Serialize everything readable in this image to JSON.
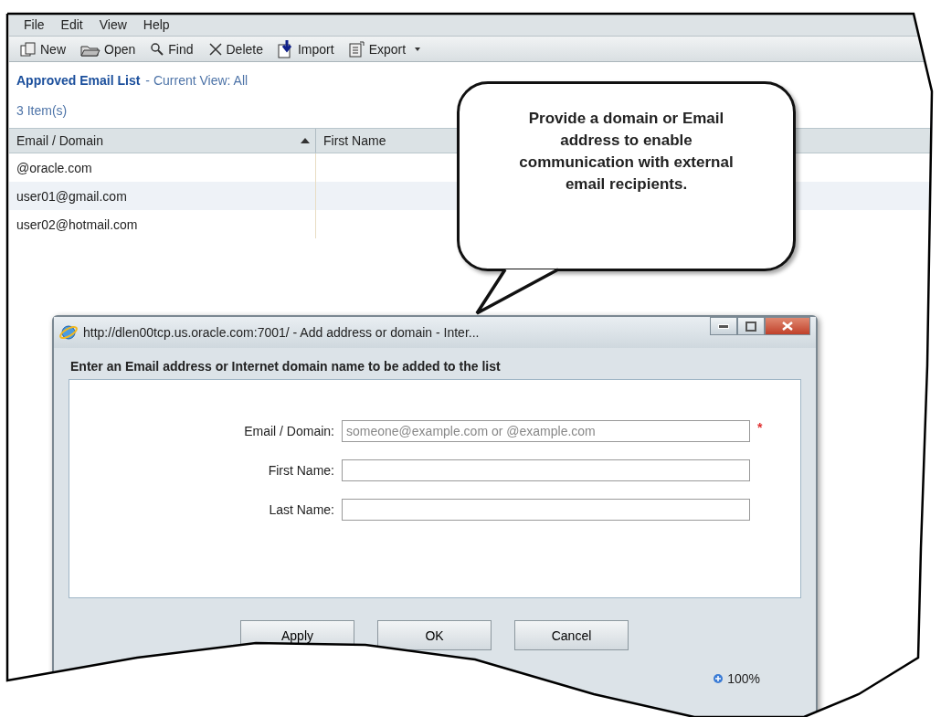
{
  "menu": [
    "File",
    "Edit",
    "View",
    "Help"
  ],
  "toolbar": [
    {
      "kind": "new",
      "label": "New",
      "has_menu": false
    },
    {
      "kind": "open",
      "label": "Open",
      "has_menu": false
    },
    {
      "kind": "find",
      "label": "Find",
      "has_menu": false
    },
    {
      "kind": "delete",
      "label": "Delete",
      "has_menu": false
    },
    {
      "kind": "import",
      "label": "Import",
      "has_menu": false
    },
    {
      "kind": "export",
      "label": "Export",
      "has_menu": true
    }
  ],
  "list": {
    "title": "Approved Email List",
    "view": "- Current View:  All",
    "count": "3  Item(s)"
  },
  "table": {
    "columns": [
      {
        "label": "Email / Domain",
        "sorted": true
      },
      {
        "label": "First Name",
        "sorted": false
      }
    ],
    "rows": [
      {
        "email_domain": "@oracle.com"
      },
      {
        "email_domain": "user01@gmail.com"
      },
      {
        "email_domain": "user02@hotmail.com"
      }
    ]
  },
  "callout": {
    "text": "Provide a domain or Email address to enable communication with external email recipients."
  },
  "dialog": {
    "title": "http://dlen00tcp.us.oracle.com:7001/ - Add address or domain - Inter...",
    "heading": "Enter an Email address or Internet domain name to be added to the list",
    "fields": [
      {
        "label": "Email / Domain:",
        "placeholder": "someone@example.com or @example.com",
        "required": true
      },
      {
        "label": "First Name:",
        "required": false
      },
      {
        "label": "Last Name:",
        "required": false
      }
    ],
    "required_mark": "*",
    "buttons": [
      "Apply",
      "OK",
      "Cancel"
    ],
    "status_bar": {
      "zoom": "100%"
    }
  }
}
